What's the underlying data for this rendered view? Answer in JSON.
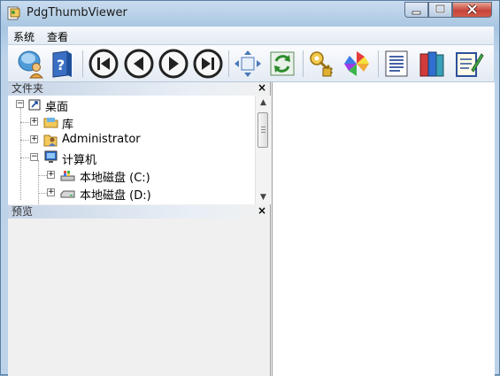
{
  "window": {
    "title": "PdgThumbViewer",
    "minimize": "0",
    "maximize": "1",
    "close": "x"
  },
  "menu": {
    "items": [
      "系统",
      "查看"
    ]
  },
  "toolbar": {
    "buttons": [
      "user-icon",
      "help-icon",
      "first-icon",
      "prev-icon",
      "next-icon",
      "last-icon",
      "fit-icon",
      "refresh-icon",
      "key-icon",
      "pinwheel-icon",
      "document-icon",
      "books-icon",
      "edit-icon"
    ]
  },
  "folders_pane": {
    "header": "文件夹",
    "close": "×",
    "tree": [
      {
        "label": "桌面",
        "expander": "−",
        "icon": "desktop-icon",
        "level": 0
      },
      {
        "label": "库",
        "expander": "+",
        "icon": "library-icon",
        "level": 1
      },
      {
        "label": "Administrator",
        "expander": "+",
        "icon": "user-folder-icon",
        "level": 1
      },
      {
        "label": "计算机",
        "expander": "−",
        "icon": "computer-icon",
        "level": 1
      },
      {
        "label": "本地磁盘 (C:)",
        "expander": "+",
        "icon": "system-drive-icon",
        "level": 2
      },
      {
        "label": "本地磁盘 (D:)",
        "expander": "+",
        "icon": "drive-icon",
        "level": 2
      }
    ]
  },
  "preview_pane": {
    "header": "预览",
    "close": "×"
  },
  "scrollbar": {
    "up": "▲",
    "down": "▼"
  }
}
